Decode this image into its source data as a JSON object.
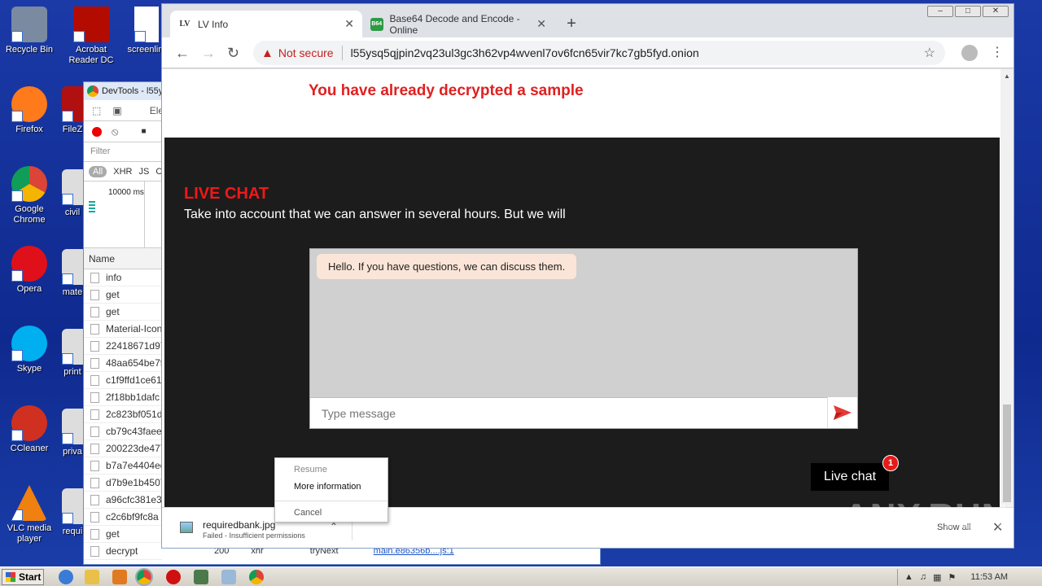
{
  "desktop": {
    "icons_left": [
      {
        "label": "Recycle Bin",
        "color": "#7a8aa0"
      },
      {
        "label": "Firefox",
        "color": "#ff7a1a"
      },
      {
        "label": "Google Chrome",
        "color": "#4285f4"
      },
      {
        "label": "Opera",
        "color": "#e0101a"
      },
      {
        "label": "Skype",
        "color": "#00aff0"
      },
      {
        "label": "CCleaner",
        "color": "#d03020"
      },
      {
        "label": "VLC media player",
        "color": "#f08010"
      }
    ],
    "icons_col2": [
      {
        "label": "Acrobat Reader DC",
        "color": "#b30b00"
      },
      {
        "label": "screenlim",
        "color": "#ffffff"
      },
      {
        "label": "FileZ",
        "color": "#b01010"
      },
      {
        "label": "civil",
        "color": "#dddddd"
      },
      {
        "label": "mate",
        "color": "#dddddd"
      },
      {
        "label": "print",
        "color": "#dddddd"
      },
      {
        "label": "priva",
        "color": "#dddddd"
      },
      {
        "label": "requi",
        "color": "#dddddd"
      }
    ]
  },
  "devtools": {
    "title": "DevTools - l55y",
    "tools_label": "Ele",
    "filter_placeholder": "Filter",
    "types": [
      "All",
      "XHR",
      "JS",
      "C"
    ],
    "overview_ms": "10000 ms",
    "name_header": "Name",
    "rows": [
      "info",
      "get",
      "get",
      "Material-Icon",
      "22418671d97",
      "48aa654be7f",
      "c1f9ffd1ce61",
      "2f18bb1dafc",
      "2c823bf051d",
      "cb79c43faee",
      "200223de477",
      "b7a7e4404ed",
      "d7b9e1b4507",
      "a96cfc381e3",
      "c2c6bf9fc8a",
      "get",
      "decrypt"
    ],
    "bottom_status": "200",
    "bottom_type": "xhr",
    "bottom_trynext": "tryNext",
    "bottom_link": "main.e86356b....js:1"
  },
  "browser": {
    "tabs": [
      {
        "title": "LV Info",
        "favicon": "LV",
        "active": true
      },
      {
        "title": "Base64 Decode and Encode - Online",
        "favicon": "B64",
        "active": false
      }
    ],
    "new_tab": "+",
    "window_controls": [
      "–",
      "□",
      "✕"
    ],
    "address": {
      "warning": "Not secure",
      "url": "l55ysq5qjpin2vq23ul3gc3h62vp4wvenl7ov6fcn65vir7kc7gb5fyd.onion"
    }
  },
  "page": {
    "sample_notice": "You have already decrypted a sample",
    "live_chat_title": "LIVE CHAT",
    "live_chat_subtitle": "Take into account that we can answer in several hours. But we will",
    "chat_messages": [
      "Hello. If you have questions, we can discuss them."
    ],
    "message_placeholder": "Type message",
    "live_chat_button": "Live chat",
    "unread_count": "1",
    "colors": {
      "accent_red": "#f01818",
      "dark_bg": "#1c1c1c",
      "bubble": "#fbe5d8"
    }
  },
  "download": {
    "filename": "requiredbank.jpg",
    "status": "Failed - Insufficient permissions",
    "show_all": "Show all"
  },
  "context_menu": {
    "items": [
      "Resume",
      "More information",
      "Cancel"
    ]
  },
  "watermark": "ANY.RUN",
  "taskbar": {
    "start": "Start",
    "clock": "11:53 AM"
  }
}
